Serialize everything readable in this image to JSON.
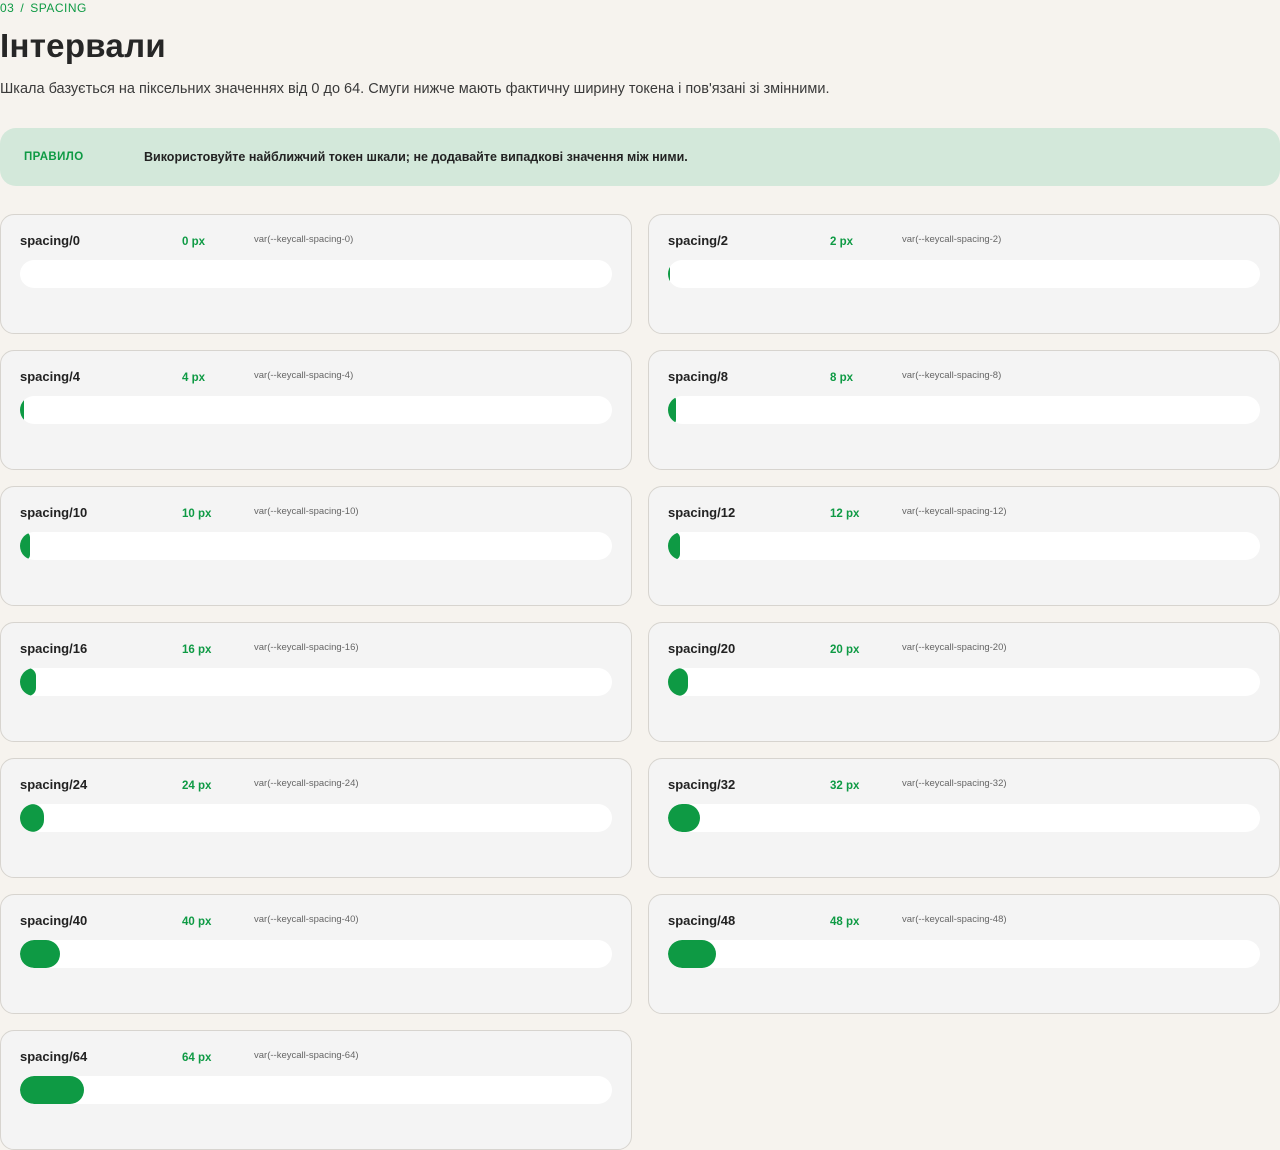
{
  "breadcrumb": {
    "number": "03",
    "separator": "/",
    "section": "SPACING"
  },
  "title": "Інтервали",
  "description": "Шкала базується на піксельних значеннях від 0 до 64. Смуги нижче мають фактичну ширину токена і пов'язані зі змінними.",
  "rule": {
    "label": "ПРАВИЛО",
    "text": "Використовуйте найближчий токен шкали; не додавайте випадкові значення між ними."
  },
  "colors": {
    "accent": "#0e9a44",
    "banner_bg": "#d3e8da",
    "page_bg": "#f6f3ee",
    "card_bg": "#f4f4f4"
  },
  "tokens": [
    {
      "name": "spacing/0",
      "value_label": "0 px",
      "var": "var(--keycall-spacing-0)",
      "value": 0
    },
    {
      "name": "spacing/2",
      "value_label": "2 px",
      "var": "var(--keycall-spacing-2)",
      "value": 2
    },
    {
      "name": "spacing/4",
      "value_label": "4 px",
      "var": "var(--keycall-spacing-4)",
      "value": 4
    },
    {
      "name": "spacing/8",
      "value_label": "8 px",
      "var": "var(--keycall-spacing-8)",
      "value": 8
    },
    {
      "name": "spacing/10",
      "value_label": "10 px",
      "var": "var(--keycall-spacing-10)",
      "value": 10
    },
    {
      "name": "spacing/12",
      "value_label": "12 px",
      "var": "var(--keycall-spacing-12)",
      "value": 12
    },
    {
      "name": "spacing/16",
      "value_label": "16 px",
      "var": "var(--keycall-spacing-16)",
      "value": 16
    },
    {
      "name": "spacing/20",
      "value_label": "20 px",
      "var": "var(--keycall-spacing-20)",
      "value": 20
    },
    {
      "name": "spacing/24",
      "value_label": "24 px",
      "var": "var(--keycall-spacing-24)",
      "value": 24
    },
    {
      "name": "spacing/32",
      "value_label": "32 px",
      "var": "var(--keycall-spacing-32)",
      "value": 32
    },
    {
      "name": "spacing/40",
      "value_label": "40 px",
      "var": "var(--keycall-spacing-40)",
      "value": 40
    },
    {
      "name": "spacing/48",
      "value_label": "48 px",
      "var": "var(--keycall-spacing-48)",
      "value": 48
    },
    {
      "name": "spacing/64",
      "value_label": "64 px",
      "var": "var(--keycall-spacing-64)",
      "value": 64
    }
  ]
}
